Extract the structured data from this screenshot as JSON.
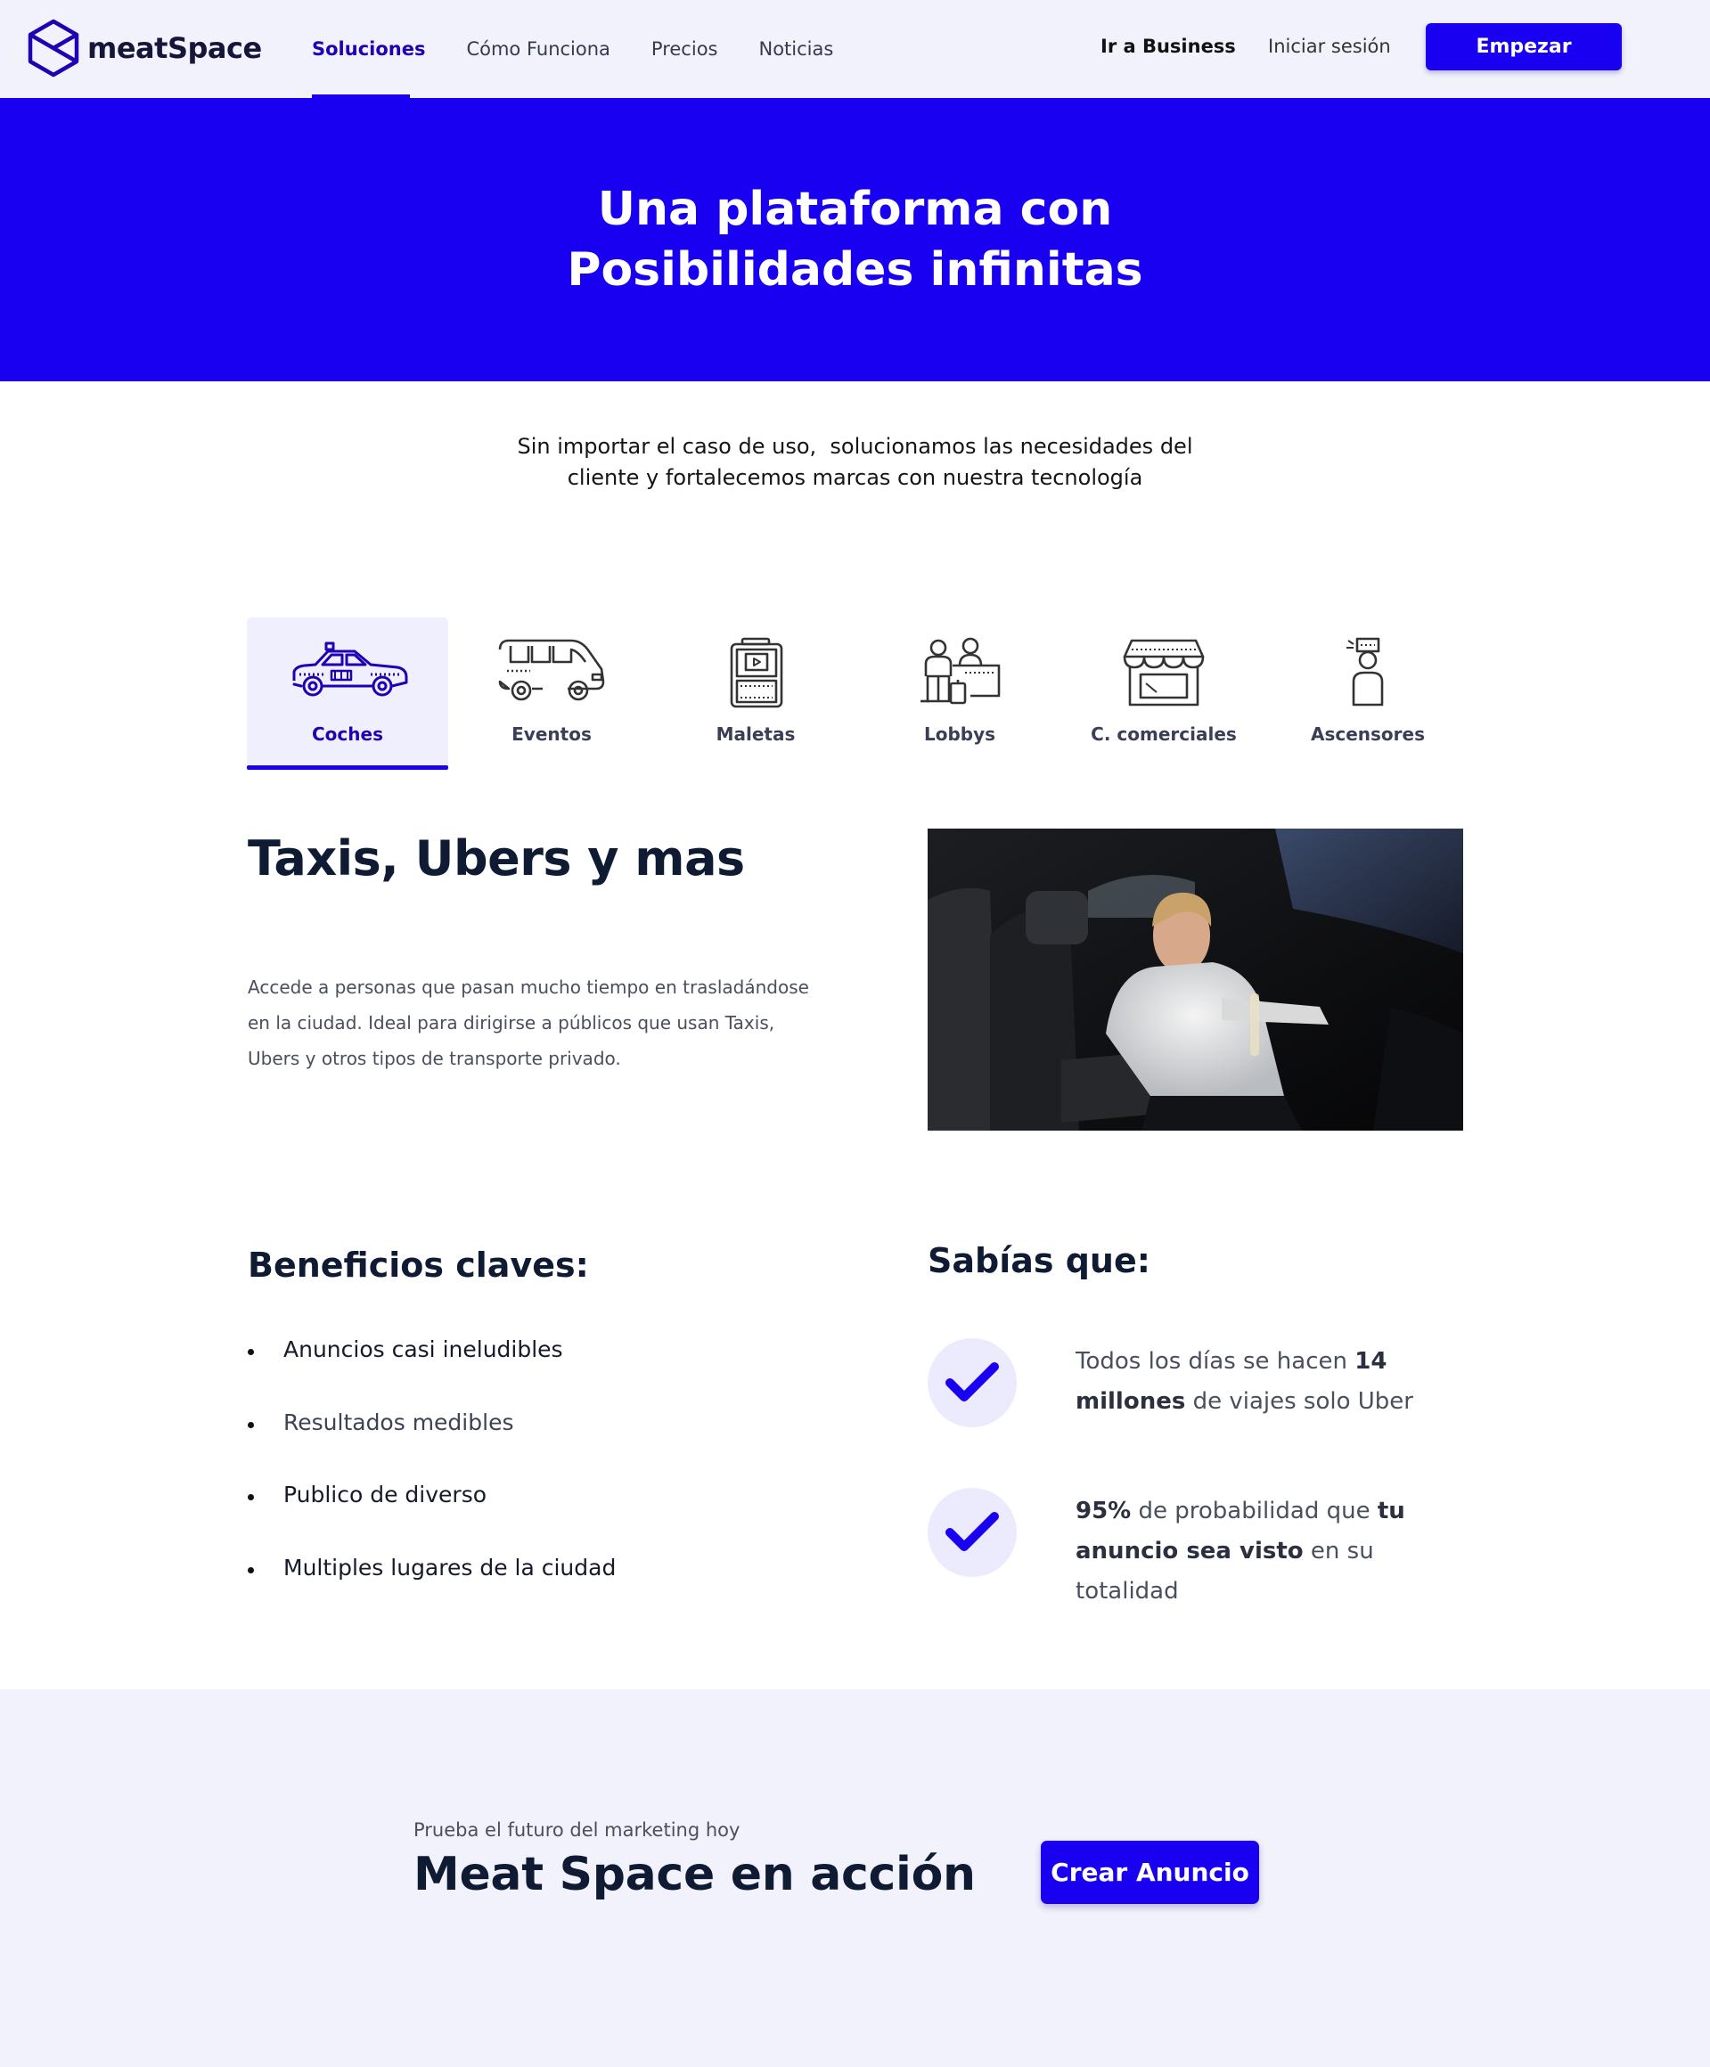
{
  "header": {
    "logo_text": "meatSpace",
    "nav": [
      {
        "label": "Soluciones"
      },
      {
        "label": "Cómo Funciona"
      },
      {
        "label": "Precios"
      },
      {
        "label": "Noticias"
      }
    ],
    "business_label": "Ir a Business",
    "login_label": "Iniciar sesión",
    "start_label": "Empezar"
  },
  "hero": {
    "line1": "Una plataforma con",
    "line2": "Posibilidades infinitas"
  },
  "intro": {
    "line1": "Sin importar el caso de uso,  solucionamos las necesidades del",
    "line2": "cliente y fortalecemos marcas con nuestra tecnología"
  },
  "tabs": [
    {
      "label": "Coches",
      "icon": "taxi-icon",
      "active": true
    },
    {
      "label": "Eventos",
      "icon": "van-icon"
    },
    {
      "label": "Maletas",
      "icon": "luggage-screen-icon"
    },
    {
      "label": "Lobbys",
      "icon": "reception-icon"
    },
    {
      "label": "C. comerciales",
      "icon": "storefront-icon"
    },
    {
      "label": "Ascensores",
      "icon": "elevator-person-icon"
    }
  ],
  "content": {
    "title": "Taxis, Ubers y mas",
    "description": "Accede a personas que pasan mucho tiempo en trasladándose en la ciudad. Ideal para dirigirse a públicos que usan Taxis, Ubers y otros tipos de transporte privado."
  },
  "benefits": {
    "title": "Beneficios claves:",
    "items": [
      "Anuncios casi ineludibles",
      "Resultados medibles",
      "Publico de diverso",
      "Multiples lugares de la ciudad"
    ]
  },
  "facts": {
    "title": "Sabías que:",
    "items": [
      {
        "p1": "Todos los días se hacen ",
        "b1": "14 millones",
        "p2": " de viajes solo Uber",
        "b2": "",
        "p3": ""
      },
      {
        "p1": "",
        "b1": "95%",
        "p2": " de probabilidad que ",
        "b2": "tu anuncio sea visto",
        "p3": " en su totalidad"
      }
    ]
  },
  "cta": {
    "small": "Prueba el futuro del marketing hoy",
    "title": "Meat Space en acción",
    "button": "Crear Anuncio"
  },
  "colors": {
    "brand": "#1a00f0",
    "light_bg": "#f2f2fc",
    "dark_text": "#0f1a33"
  }
}
